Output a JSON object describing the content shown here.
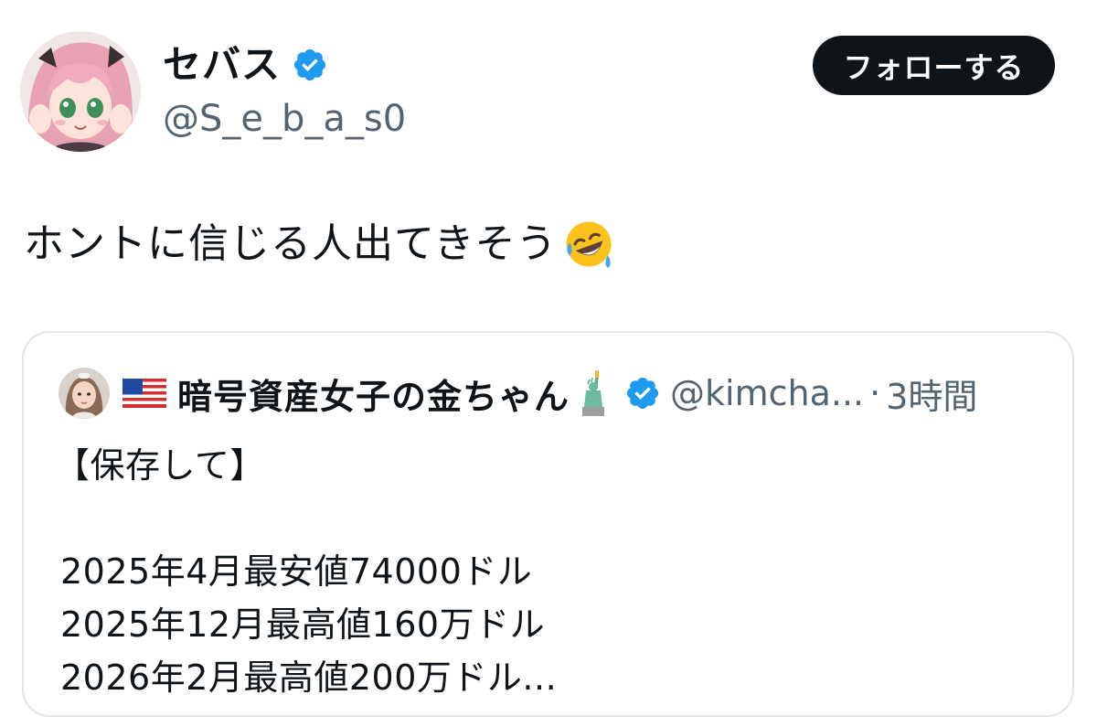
{
  "author": {
    "display_name": "セバス",
    "handle": "@S_e_b_a_s0",
    "verified_color": "#1d9bf0",
    "avatar_icon": "anime-girl-avatar"
  },
  "follow_button": {
    "label": "フォローする",
    "color": "#0f1419"
  },
  "tweet": {
    "text": "ホントに信じる人出てきそう",
    "emoji": "rolling-on-floor-laughing-emoji"
  },
  "quote": {
    "avatar_icon": "woman-avatar",
    "flag_icon": "us-flag-icon",
    "display_name": "暗号資産女子の金ちゃん",
    "name_emoji": "statue-of-liberty-icon",
    "handle": "@kimcha...",
    "separator": "·",
    "time": "3時間",
    "lines": [
      "【保存して】",
      "",
      "2025年4月最安値74000ドル",
      "2025年12月最高値160万ドル",
      "2026年2月最高値200万ドル..."
    ]
  }
}
